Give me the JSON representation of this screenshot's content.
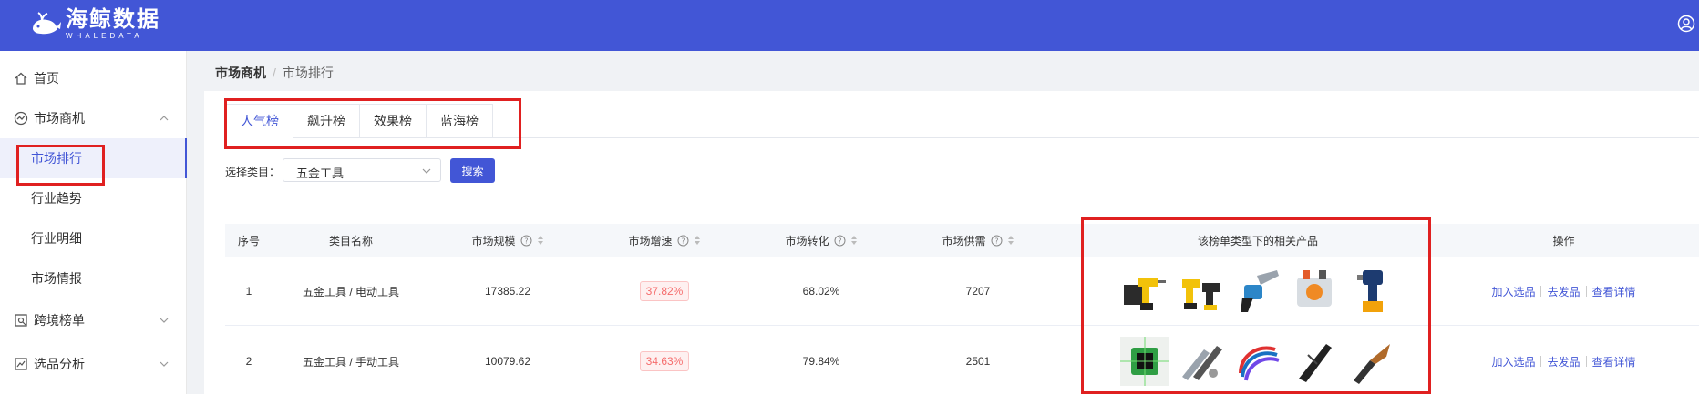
{
  "header": {
    "logo_cn": "海鲸数据",
    "logo_en": "WHALEDATA",
    "brand_color": "#4256d6"
  },
  "sidebar": {
    "items": [
      {
        "label": "首页",
        "icon": "home-icon"
      },
      {
        "label": "市场商机",
        "icon": "trend-icon",
        "expanded": true
      },
      {
        "label": "市场排行",
        "active": true
      },
      {
        "label": "行业趋势"
      },
      {
        "label": "行业明细"
      },
      {
        "label": "市场情报"
      },
      {
        "label": "跨境榜单",
        "icon": "ranking-icon",
        "expanded": false
      },
      {
        "label": "选品分析",
        "icon": "analysis-icon",
        "expanded": false
      }
    ]
  },
  "breadcrumb": {
    "first": "市场商机",
    "sep": "/",
    "current": "市场排行"
  },
  "tabs": [
    {
      "label": "人气榜",
      "active": true
    },
    {
      "label": "飙升榜"
    },
    {
      "label": "效果榜"
    },
    {
      "label": "蓝海榜"
    }
  ],
  "filter": {
    "label": "选择类目：",
    "selected": "五金工具",
    "search_label": "搜索"
  },
  "table": {
    "columns": [
      "序号",
      "类目名称",
      "市场规模",
      "市场增速",
      "市场转化",
      "市场供需",
      "该榜单类型下的相关产品",
      "操作"
    ],
    "rows": [
      {
        "index": "1",
        "category": "五金工具 / 电动工具",
        "scale": "17385.22",
        "growth": "37.82%",
        "conversion": "68.02%",
        "supply": "7207",
        "products": [
          "drill-kit",
          "drill-kit-2",
          "chainsaw",
          "tool-set",
          "impact-driver"
        ]
      },
      {
        "index": "2",
        "category": "五金工具 / 手动工具",
        "scale": "10079.62",
        "growth": "34.63%",
        "conversion": "79.84%",
        "supply": "2501",
        "products": [
          "laser-level",
          "multi-tool",
          "cable-ties",
          "knife",
          "pocket-knife"
        ]
      }
    ],
    "actions": [
      "加入选品",
      "去发品",
      "查看详情"
    ]
  },
  "highlight_color": "#e02020"
}
